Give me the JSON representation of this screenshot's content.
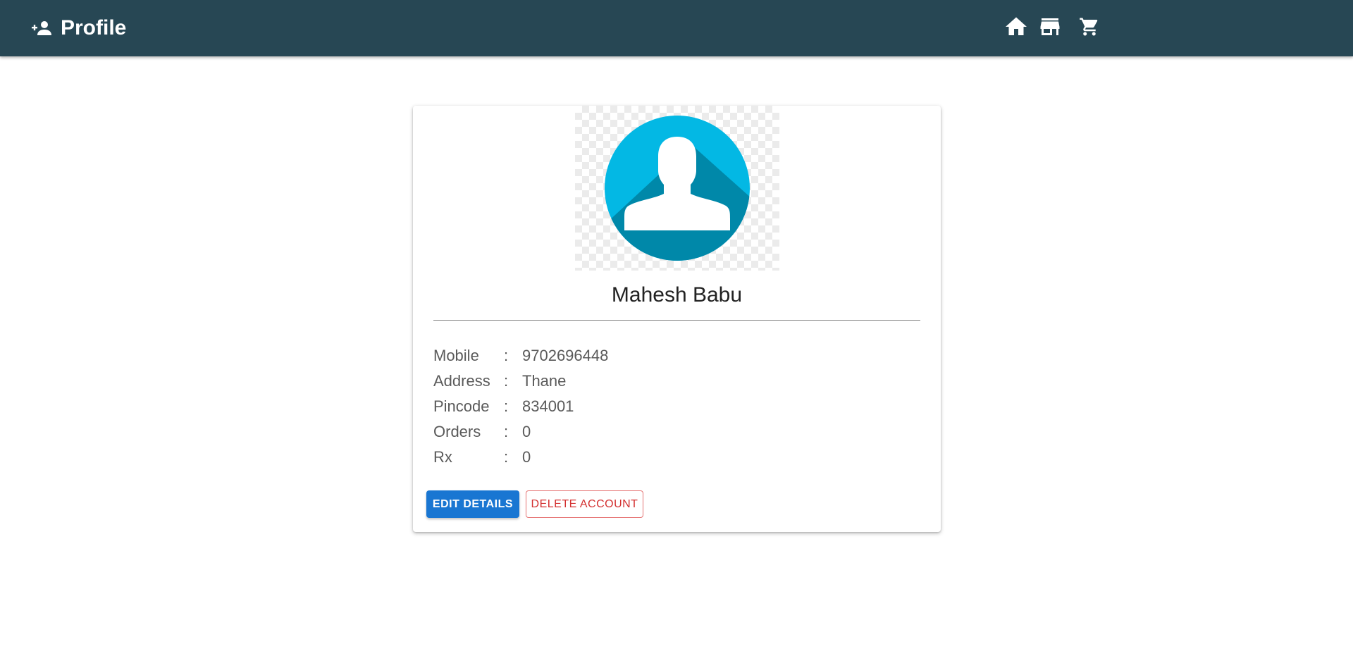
{
  "app": {
    "title": "Profile",
    "brand_icon": "person-add-icon",
    "bar_color": "#274754",
    "nav": [
      {
        "name": "home",
        "icon": "home-icon"
      },
      {
        "name": "store",
        "icon": "store-icon"
      },
      {
        "name": "cart",
        "icon": "cart-icon"
      }
    ]
  },
  "profile": {
    "avatar_icon": "user-avatar-icon",
    "name": "Mahesh Babu",
    "fields": [
      {
        "label": "Mobile",
        "sep": ":",
        "value": "9702696448"
      },
      {
        "label": "Address",
        "sep": ":",
        "value": "Thane"
      },
      {
        "label": "Pincode",
        "sep": ":",
        "value": "834001"
      },
      {
        "label": "Orders",
        "sep": ":",
        "value": "0"
      },
      {
        "label": "Rx",
        "sep": ":",
        "value": "0"
      }
    ]
  },
  "actions": {
    "edit_label": "EDIT DETAILS",
    "delete_label": "DELETE ACCOUNT",
    "edit_color": "#1976d2",
    "delete_color": "#d32f2f"
  }
}
